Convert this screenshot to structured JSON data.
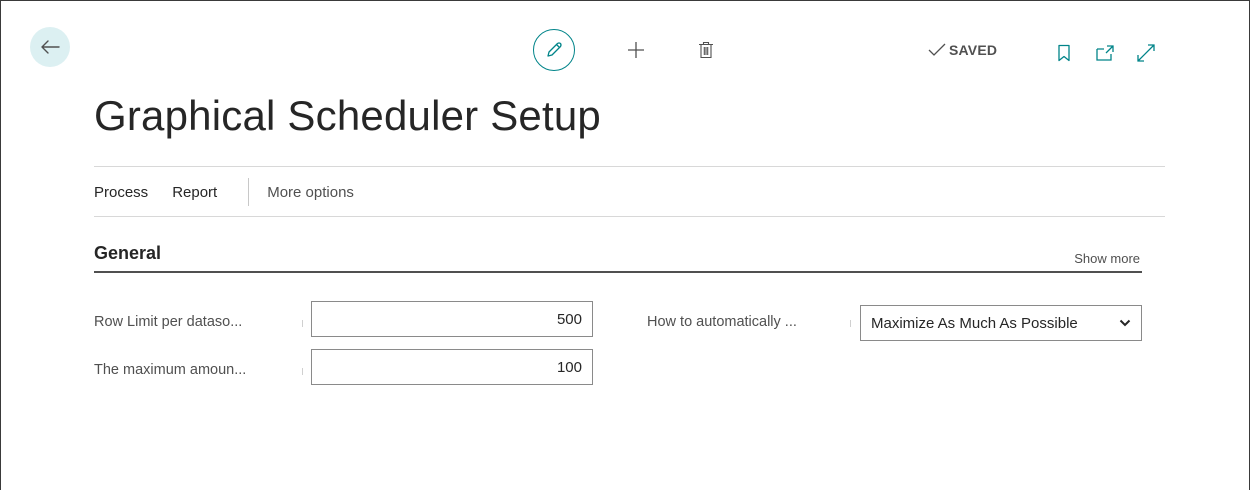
{
  "header": {
    "saved_label": "SAVED",
    "back_icon": "arrow-left-icon",
    "edit_icon": "pencil-icon",
    "new_icon": "plus-icon",
    "delete_icon": "trash-icon",
    "bookmark_icon": "bookmark-icon",
    "open_new_icon": "open-in-new-window-icon",
    "expand_icon": "expand-icon"
  },
  "page": {
    "title": "Graphical Scheduler Setup"
  },
  "actions": {
    "process": "Process",
    "report": "Report",
    "more_options": "More options"
  },
  "general": {
    "title": "General",
    "show_more": "Show more",
    "fields": [
      {
        "label": "Row Limit per dataso...",
        "value": "500"
      },
      {
        "label": "The maximum amoun...",
        "value": "100"
      },
      {
        "label": "How to automatically ...",
        "value": "Maximize As Much As Possible"
      }
    ]
  },
  "colors": {
    "accent": "#008489",
    "back_button_bg": "#dcf0f2"
  }
}
